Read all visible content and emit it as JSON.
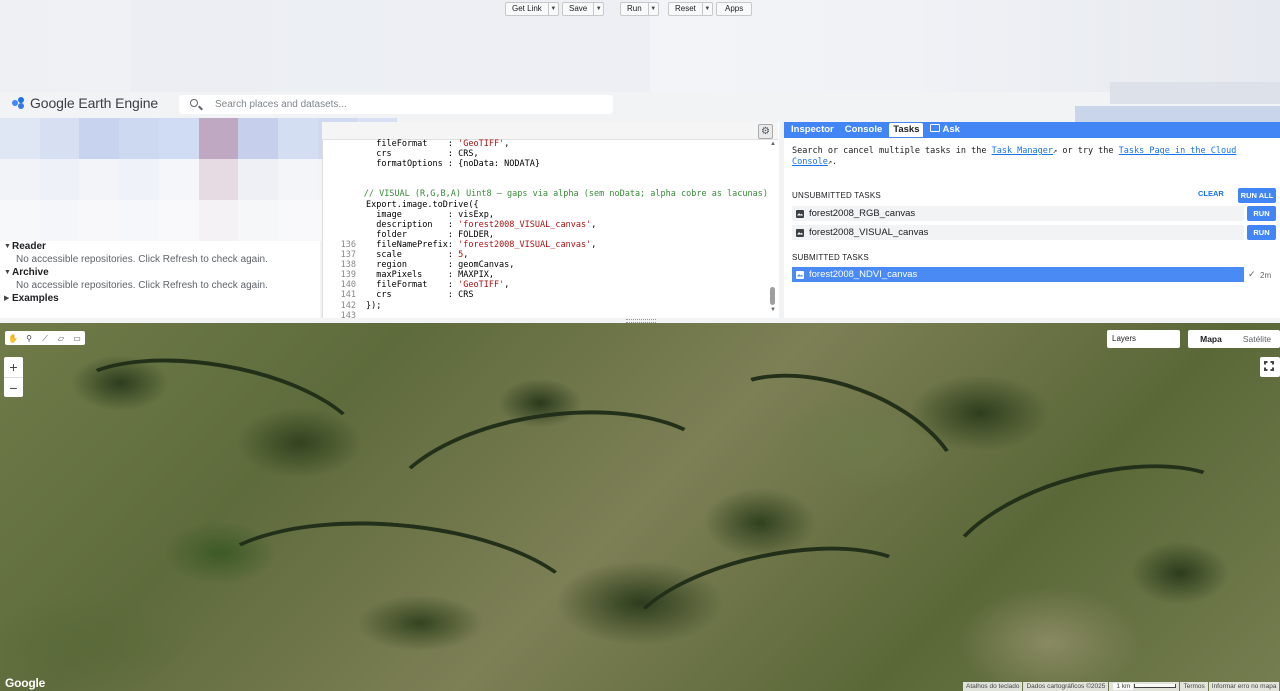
{
  "app": {
    "title": "Google Earth Engine"
  },
  "search": {
    "placeholder": "Search places and datasets..."
  },
  "scripts_tree": {
    "items": [
      {
        "label": "Reader",
        "status": "No accessible repositories. Click Refresh to check again."
      },
      {
        "label": "Archive",
        "status": "No accessible repositories. Click Refresh to check again."
      },
      {
        "label": "Examples"
      }
    ]
  },
  "editor": {
    "toolbar": {
      "get_link": "Get Link",
      "save": "Save",
      "run": "Run",
      "reset": "Reset",
      "apps": "Apps"
    },
    "lines": [
      {
        "num": "",
        "text": "  fileFormat    : ",
        "str": "'GeoTIFF'",
        "tail": ","
      },
      {
        "num": "",
        "text": "  crs           : CRS,",
        "str": "",
        "tail": ""
      },
      {
        "num": "",
        "text": "  formatOptions : {noData: NODATA}",
        "str": "",
        "tail": ""
      },
      {
        "num": "",
        "text": "",
        "str": "",
        "tail": ""
      },
      {
        "num": "",
        "text": "",
        "str": "",
        "tail": ""
      },
      {
        "num": "",
        "comment": "// VISUAL (R,G,B,A) Uint8 — gaps via alpha (sem noData; alpha cobre as lacunas)"
      },
      {
        "num": "",
        "text": "Export.image.toDrive({",
        "str": "",
        "tail": ""
      },
      {
        "num": "",
        "text": "  image         : visExp,",
        "str": "",
        "tail": ""
      },
      {
        "num": "",
        "text": "  description   : ",
        "str": "'forest2008_VISUAL_canvas'",
        "tail": ","
      },
      {
        "num": "",
        "text": "  folder        : FOLDER,",
        "str": "",
        "tail": ""
      },
      {
        "num": "136",
        "text": "  fileNamePrefix: ",
        "str": "'forest2008_VISUAL_canvas'",
        "tail": ","
      },
      {
        "num": "137",
        "text": "  scale         : ",
        "str": "5",
        "tail": ","
      },
      {
        "num": "138",
        "text": "  region        : geomCanvas,",
        "str": "",
        "tail": ""
      },
      {
        "num": "139",
        "text": "  maxPixels     : MAXPIX,",
        "str": "",
        "tail": ""
      },
      {
        "num": "140",
        "text": "  fileFormat    : ",
        "str": "'GeoTIFF'",
        "tail": ","
      },
      {
        "num": "141",
        "text": "  crs           : CRS",
        "str": "",
        "tail": ""
      },
      {
        "num": "142",
        "text": "});",
        "str": "",
        "tail": ""
      },
      {
        "num": "143",
        "text": "",
        "str": "",
        "tail": ""
      }
    ]
  },
  "right_panel": {
    "tabs": [
      "Inspector",
      "Console",
      "Tasks",
      "Ask"
    ],
    "active_tab": "Tasks",
    "intro": {
      "a": "Search or cancel multiple tasks in the ",
      "link1": "Task Manager",
      "b": " or try the ",
      "link2": "Tasks Page in the Cloud Console",
      "c": "."
    },
    "unsubmitted_header": "UNSUBMITTED TASKS",
    "clear_label": "CLEAR",
    "run_all_label": "RUN ALL",
    "unsubmitted": [
      {
        "name": "forest2008_RGB_canvas",
        "action": "RUN"
      },
      {
        "name": "forest2008_VISUAL_canvas",
        "action": "RUN"
      }
    ],
    "submitted_header": "SUBMITTED TASKS",
    "submitted": [
      {
        "name": "forest2008_NDVI_canvas",
        "status_icon": "check-icon",
        "age": "2m"
      }
    ]
  },
  "map": {
    "layers_label": "Layers",
    "map_types": [
      "Mapa",
      "Satélite"
    ],
    "active_map_type": "Mapa",
    "zoom_in": "+",
    "zoom_out": "−",
    "google_logo": "Google",
    "attribution": [
      "Atalhos do teclado",
      "Dados cartográficos ©2025",
      "1 km",
      "Termos",
      "Informar erro no mapa"
    ]
  }
}
